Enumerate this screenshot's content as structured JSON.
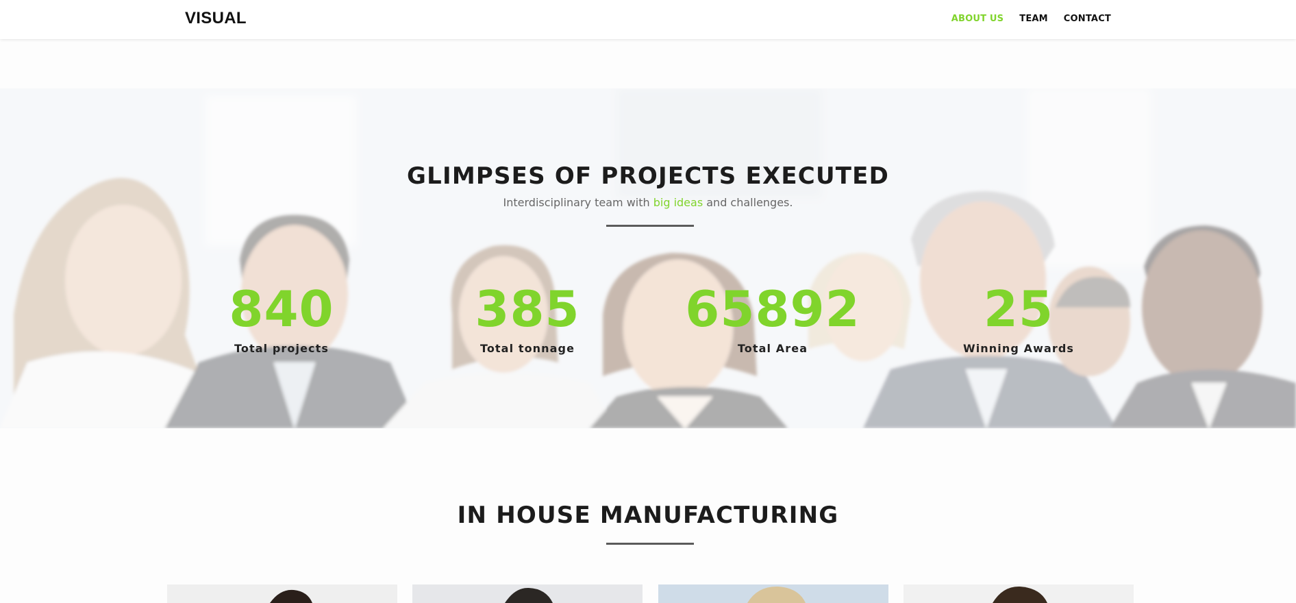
{
  "header": {
    "logo": "VISUAL",
    "nav": [
      {
        "label": "ABOUT US",
        "active": true
      },
      {
        "label": "TEAM",
        "active": false
      },
      {
        "label": "CONTACT",
        "active": false
      }
    ]
  },
  "hero": {
    "title": "GLIMPSES OF PROJECTS EXECUTED",
    "subtitle": {
      "before": "Interdisciplinary team with ",
      "highlight": "big ideas",
      "after": " and challenges."
    },
    "background": "people-group-photo",
    "stats": [
      {
        "value": "840",
        "label": "Total projects"
      },
      {
        "value": "385",
        "label": "Total tonnage"
      },
      {
        "value": "65892",
        "label": "Total Area"
      },
      {
        "value": "25",
        "label": "Winning Awards"
      }
    ]
  },
  "manufacturing": {
    "title": "IN HOUSE MANUFACTURING",
    "cards": [
      {
        "image": "team-member-photo"
      },
      {
        "image": "team-member-photo"
      },
      {
        "image": "team-member-photo"
      },
      {
        "image": "team-member-photo"
      }
    ]
  },
  "colors": {
    "accent": "#80d42c",
    "text": "#1c1c1c",
    "muted": "#666666",
    "divider": "#5b5b5b"
  }
}
